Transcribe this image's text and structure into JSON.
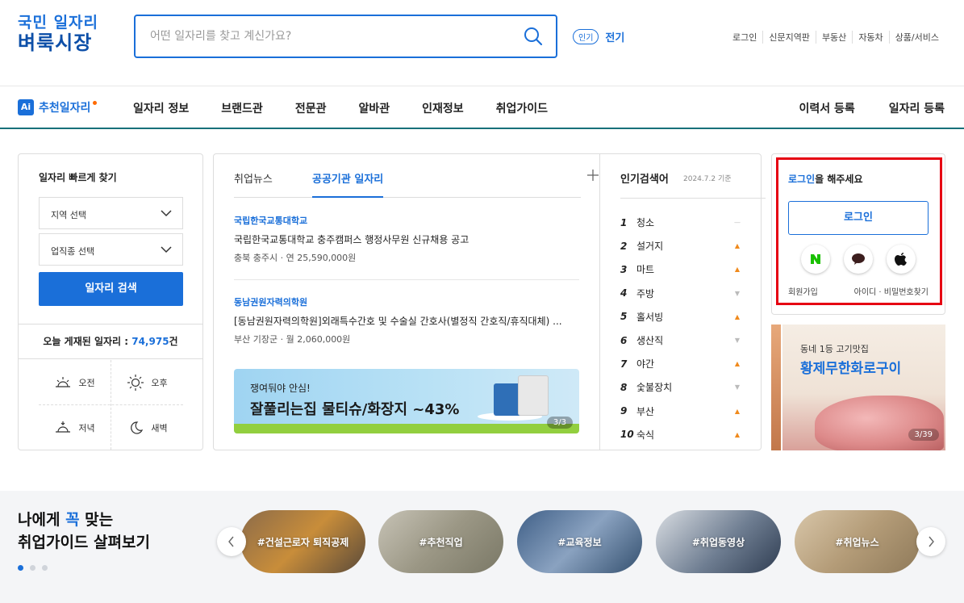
{
  "header": {
    "logo_line1": "국민 일자리",
    "logo_line2": "벼룩시장",
    "search_placeholder": "어떤 일자리를 찾고 계신가요?",
    "hot_badge": "인기",
    "hot_term": "전기",
    "util_links": [
      "로그인",
      "신문지역판",
      "부동산",
      "자동차",
      "상품/서비스"
    ]
  },
  "nav": {
    "ai_badge": "Ai",
    "ai_label": "추천일자리",
    "items": [
      "일자리 정보",
      "브랜드관",
      "전문관",
      "알바관",
      "인재정보",
      "취업가이드"
    ],
    "right": [
      "이력서 등록",
      "일자리 등록"
    ]
  },
  "quick_find": {
    "title": "일자리 빠르게 찾기",
    "region_select": "지역 선택",
    "job_select": "업직종 선택",
    "search_button": "일자리 검색",
    "today_prefix": "오늘 게재된 일자리 : ",
    "today_count": "74,975",
    "today_suffix": "건",
    "times": [
      "오전",
      "오후",
      "저녁",
      "새벽"
    ]
  },
  "news": {
    "tabs": [
      "취업뉴스",
      "공공기관 일자리"
    ],
    "active_tab": "공공기관 일자리",
    "articles": [
      {
        "org": "국립한국교통대학교",
        "title": "국립한국교통대학교 충주캠퍼스 행정사무원 신규채용 공고",
        "meta": "충북 충주시 · 연 25,590,000원"
      },
      {
        "org": "동남권원자력의학원",
        "title": "[동남권원자력의학원]외래특수간호 및 수술실 간호사(별정직 간호직/휴직대체) ...",
        "meta": "부산 기장군 · 월 2,060,000원"
      }
    ],
    "banner": {
      "sub": "쟁여둬야 안심!",
      "main": "잘풀리는집 물티슈/화장지 ~43%",
      "pager": "3/3"
    }
  },
  "keywords": {
    "title": "인기검색어",
    "date": "2024.7.2 기준",
    "items": [
      {
        "rank": "1",
        "word": "청소",
        "trend": "same"
      },
      {
        "rank": "2",
        "word": "설거지",
        "trend": "up"
      },
      {
        "rank": "3",
        "word": "마트",
        "trend": "up"
      },
      {
        "rank": "4",
        "word": "주방",
        "trend": "down"
      },
      {
        "rank": "5",
        "word": "홀서빙",
        "trend": "up"
      },
      {
        "rank": "6",
        "word": "생산직",
        "trend": "down"
      },
      {
        "rank": "7",
        "word": "야간",
        "trend": "up"
      },
      {
        "rank": "8",
        "word": "숯불장치",
        "trend": "down"
      },
      {
        "rank": "9",
        "word": "부산",
        "trend": "up"
      },
      {
        "rank": "10",
        "word": "숙식",
        "trend": "up"
      }
    ]
  },
  "login": {
    "msg_link": "로그인",
    "msg_rest": "을 해주세요",
    "button": "로그인",
    "social": [
      "naver-icon",
      "kakao-icon",
      "apple-icon"
    ],
    "join": "회원가입",
    "find": "아이디 · 비밀번호찾기"
  },
  "ad": {
    "sub": "동네 1등 고기맛집",
    "title": "황제무한화로구이",
    "pager": "3/39"
  },
  "guide": {
    "title_pre": "나에게 ",
    "title_hl": "꼭",
    "title_post": " 맞는",
    "title_line2": "취업가이드 살펴보기",
    "pills": [
      "#건설근로자 퇴직공제",
      "#추천직업",
      "#교육정보",
      "#취업동영상",
      "#취업뉴스"
    ]
  },
  "colors": {
    "accent": "#1a6fd9",
    "highlight": "#e60012",
    "trend_up": "#f08a1c"
  }
}
